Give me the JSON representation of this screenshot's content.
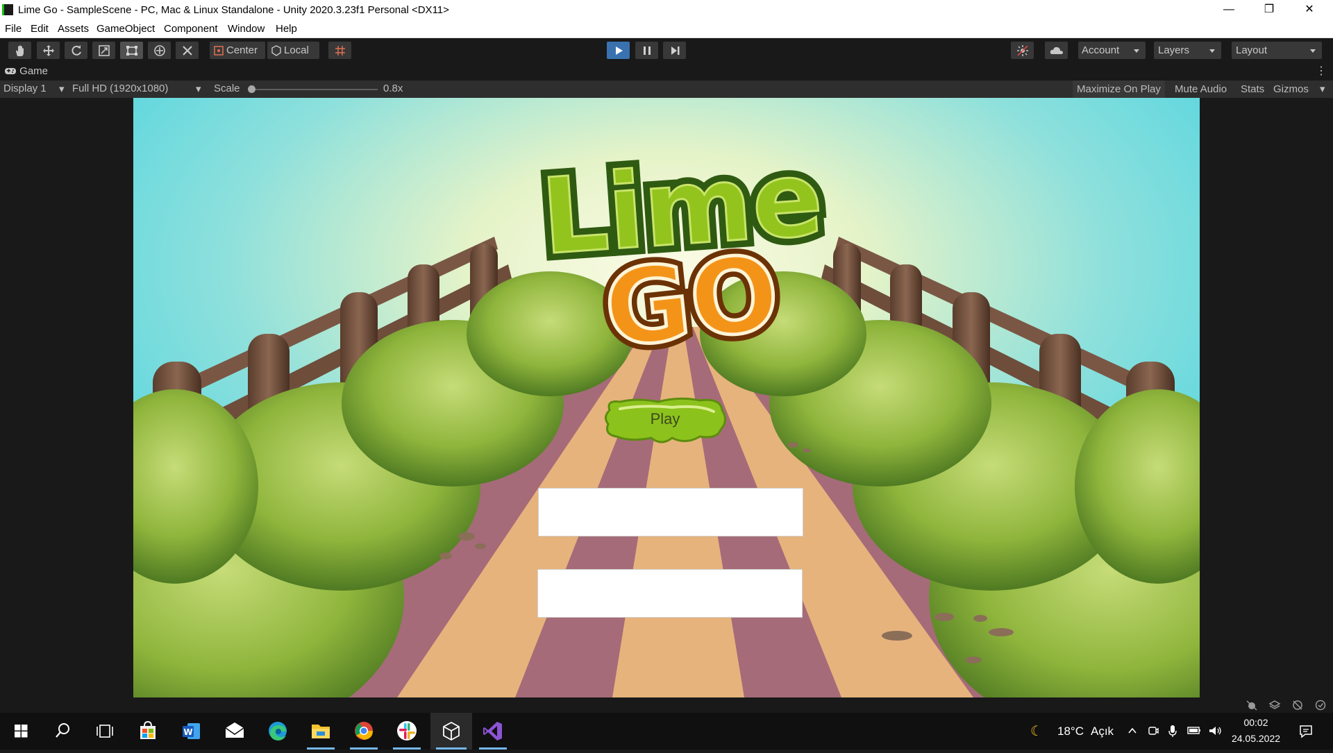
{
  "window": {
    "title": "Lime Go - SampleScene - PC, Mac & Linux Standalone - Unity 2020.3.23f1 Personal <DX11>",
    "minimize_glyph": "—",
    "maximize_glyph": "❐",
    "close_glyph": "✕"
  },
  "menu": [
    "File",
    "Edit",
    "Assets",
    "GameObject",
    "Component",
    "Window",
    "Help"
  ],
  "toolbar": {
    "tools": [
      "hand-tool-icon",
      "move-tool-icon",
      "rotate-tool-icon",
      "scale-tool-icon",
      "rect-tool-icon",
      "transform-tool-icon",
      "custom-tool-icon"
    ],
    "pivot_label": "Center",
    "space_label": "Local",
    "account_label": "Account",
    "layers_label": "Layers",
    "layout_label": "Layout"
  },
  "game_tab": {
    "label": "Game"
  },
  "game_bar": {
    "display": "Display 1",
    "resolution": "Full HD (1920x1080)",
    "scale_label": "Scale",
    "scale_value": "0.8x",
    "scale_fraction": 0.0,
    "maximize_on_play": "Maximize On Play",
    "mute_audio": "Mute Audio",
    "stats": "Stats",
    "gizmos": "Gizmos"
  },
  "game": {
    "logo_line1": "Lime",
    "logo_line2": "GO",
    "play_button": "Play",
    "input1_value": "",
    "input2_value": ""
  },
  "taskbar": {
    "apps": [
      "windows-start-icon",
      "search-icon",
      "task-view-icon",
      "store-icon",
      "word-icon",
      "mail-icon",
      "edge-icon",
      "file-explorer-icon",
      "chrome-icon",
      "slack-icon",
      "unity-icon",
      "visual-studio-icon"
    ],
    "weather_temp": "18°C",
    "weather_text": "Açık",
    "time": "00:02",
    "date": "24.05.2022"
  },
  "colors": {
    "unity_dark": "#191919",
    "play_blue": "#3a72b0",
    "sky_top": "#4fd6e0",
    "slime_green": "#8cc21c",
    "logo_orange": "#f39419"
  }
}
